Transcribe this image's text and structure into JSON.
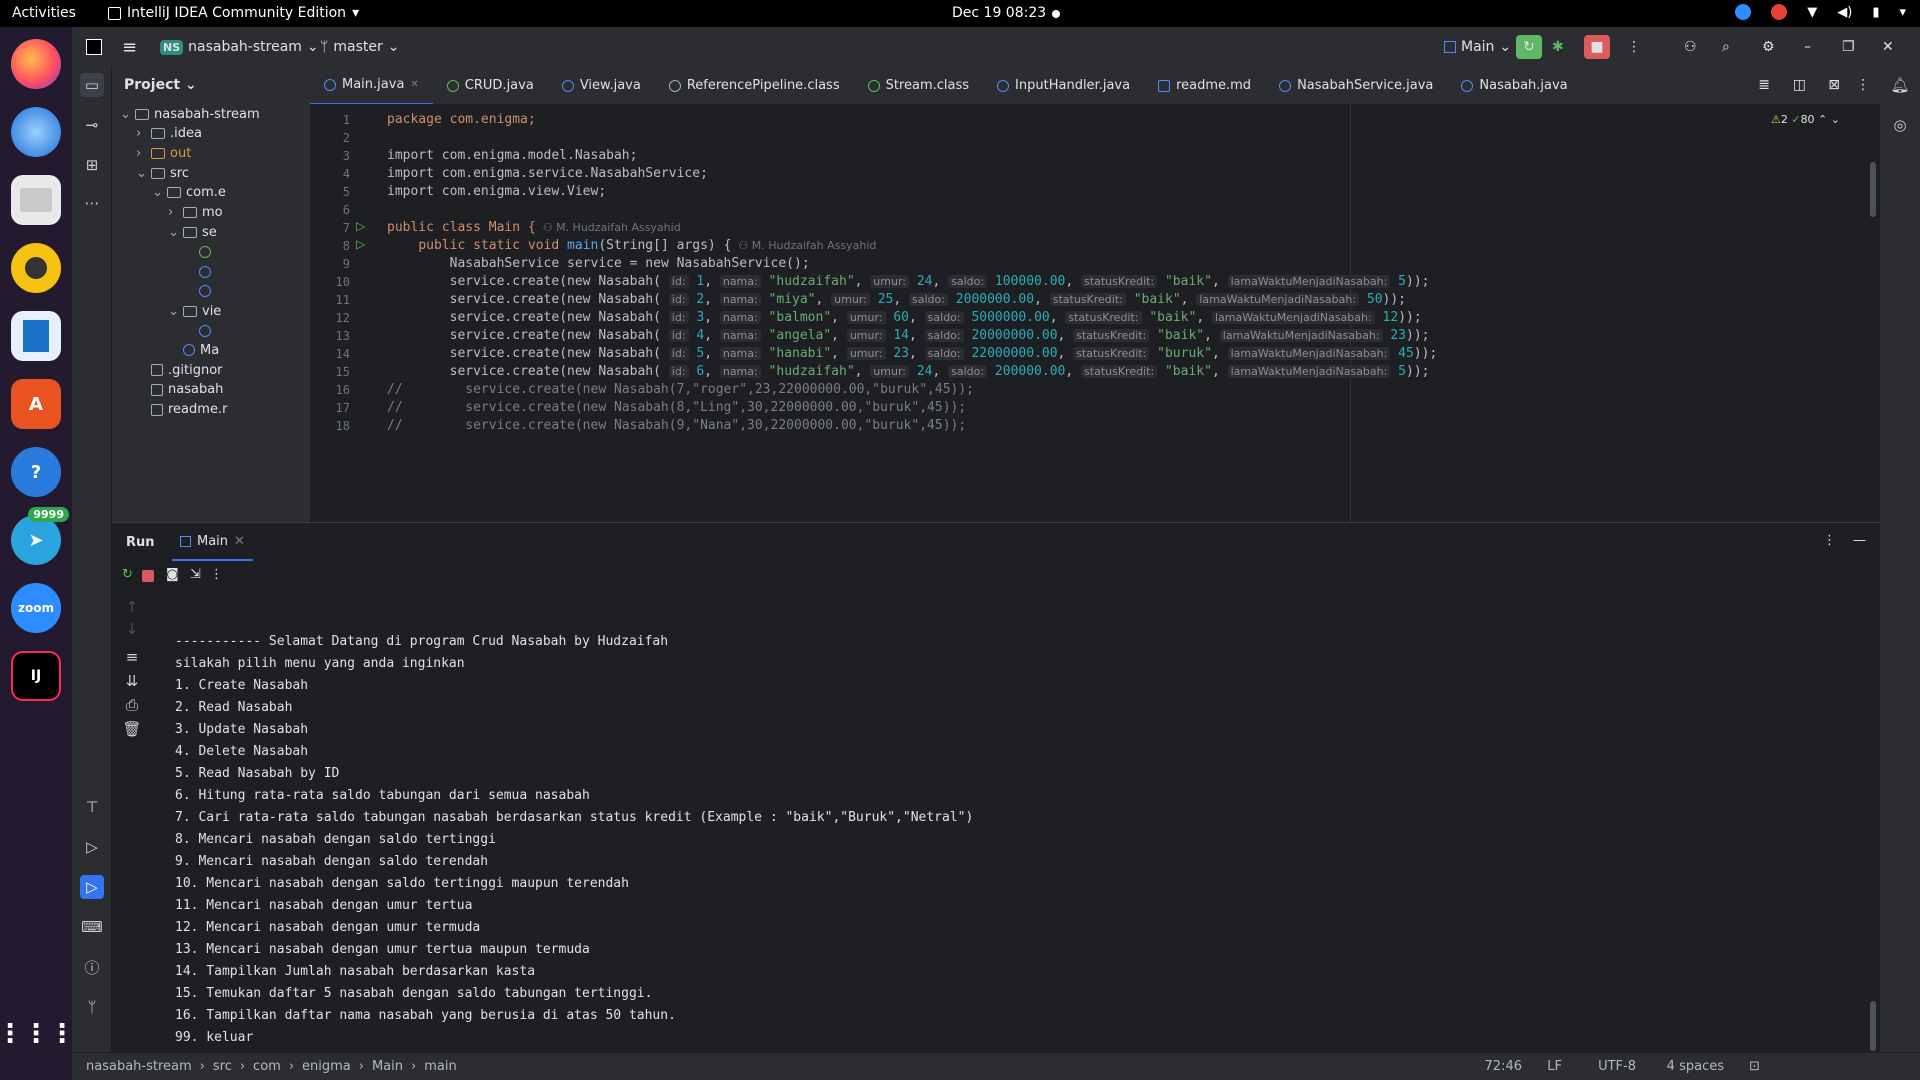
{
  "topbar": {
    "activities": "Activities",
    "app_name": "IntelliJ IDEA Community Edition",
    "datetime": "Dec 19  08:23"
  },
  "dock": {
    "telegram_badge": "9999",
    "zoom_label": "zoom",
    "intellij_label": "IJ"
  },
  "header": {
    "project_badge": "NS",
    "project_name": "nasabah-stream",
    "branch": "master",
    "run_config": "Main"
  },
  "project_panel": {
    "title": "Project",
    "items": [
      {
        "label": "nasabah-stream",
        "depth": 0,
        "kind": "folder",
        "expanded": true
      },
      {
        "label": ".idea",
        "depth": 1,
        "kind": "folder",
        "expanded": false
      },
      {
        "label": "out",
        "depth": 1,
        "kind": "folder-orange",
        "expanded": false
      },
      {
        "label": "src",
        "depth": 1,
        "kind": "folder",
        "expanded": true
      },
      {
        "label": "com.e",
        "depth": 2,
        "kind": "package",
        "expanded": true
      },
      {
        "label": "mo",
        "depth": 3,
        "kind": "package",
        "expanded": false
      },
      {
        "label": "se",
        "depth": 3,
        "kind": "package",
        "expanded": true
      },
      {
        "label": "",
        "depth": 4,
        "kind": "iface"
      },
      {
        "label": "",
        "depth": 4,
        "kind": "class"
      },
      {
        "label": "",
        "depth": 4,
        "kind": "class"
      },
      {
        "label": "vie",
        "depth": 3,
        "kind": "package",
        "expanded": true
      },
      {
        "label": "",
        "depth": 4,
        "kind": "class"
      },
      {
        "label": "Ma",
        "depth": 3,
        "kind": "class"
      },
      {
        "label": ".gitignor",
        "depth": 1,
        "kind": "file"
      },
      {
        "label": "nasabah",
        "depth": 1,
        "kind": "file"
      },
      {
        "label": "readme.r",
        "depth": 1,
        "kind": "md"
      }
    ]
  },
  "tabs": [
    {
      "label": "Main.java",
      "active": true
    },
    {
      "label": "CRUD.java"
    },
    {
      "label": "View.java"
    },
    {
      "label": "ReferencePipeline.class"
    },
    {
      "label": "Stream.class"
    },
    {
      "label": "InputHandler.java"
    },
    {
      "label": "readme.md"
    },
    {
      "label": "NasabahService.java"
    },
    {
      "label": "Nasabah.java"
    }
  ],
  "inspections": {
    "warnings": "2",
    "ok": "80"
  },
  "code": {
    "l1": "package com.enigma;",
    "l3": "import com.enigma.model.Nasabah;",
    "l4": "import com.enigma.service.NasabahService;",
    "l5": "import com.enigma.view.View;",
    "l7a": "public class Main {",
    "author": "M. Hudzaifah Assyahid",
    "l8a": "public static void ",
    "l8b": "main",
    "l8c": "(String[] args) {",
    "l9": "NasabahService service = new NasabahService();",
    "rows": [
      {
        "id": "1",
        "nama": "\"hudzaifah\"",
        "umur": "24",
        "saldo": "100000.00",
        "status": "\"baik\"",
        "lama": "5"
      },
      {
        "id": "2",
        "nama": "\"miya\"",
        "umur": "25",
        "saldo": "2000000.00",
        "status": "\"baik\"",
        "lama": "50"
      },
      {
        "id": "3",
        "nama": "\"balmon\"",
        "umur": "60",
        "saldo": "5000000.00",
        "status": "\"baik\"",
        "lama": "12"
      },
      {
        "id": "4",
        "nama": "\"angela\"",
        "umur": "14",
        "saldo": "20000000.00",
        "status": "\"baik\"",
        "lama": "23"
      },
      {
        "id": "5",
        "nama": "\"hanabi\"",
        "umur": "23",
        "saldo": "22000000.00",
        "status": "\"buruk\"",
        "lama": "45"
      },
      {
        "id": "6",
        "nama": "\"hudzaifah\"",
        "umur": "24",
        "saldo": "200000.00",
        "status": "\"baik\"",
        "lama": "5"
      }
    ],
    "hint_id": "id:",
    "hint_nama": "nama:",
    "hint_umur": "umur:",
    "hint_saldo": "saldo:",
    "hint_status": "statusKredit:",
    "hint_lama": "lamaWaktuMenjadiNasabah:",
    "c16": "//        service.create(new Nasabah(7,\"roger\",23,22000000.00,\"buruk\",45));",
    "c17": "//        service.create(new Nasabah(8,\"Ling\",30,22000000.00,\"buruk\",45));",
    "c18": "//        service.create(new Nasabah(9,\"Nana\",30,22000000.00,\"buruk\",45));"
  },
  "run": {
    "title": "Run",
    "tab": "Main"
  },
  "console": [
    "----------- Selamat Datang di program Crud Nasabah by Hudzaifah",
    "silakah pilih menu yang anda inginkan",
    "1. Create Nasabah",
    "2. Read Nasabah",
    "3. Update Nasabah",
    "4. Delete Nasabah",
    "5. Read Nasabah by ID",
    "6. Hitung rata-rata saldo tabungan dari semua nasabah",
    "7. Cari rata-rata saldo tabungan nasabah berdasarkan status kredit (Example : \"baik\",\"Buruk\",\"Netral\")",
    "8. Mencari nasabah dengan saldo tertinggi",
    "9. Mencari nasabah dengan saldo terendah",
    "10. Mencari nasabah dengan saldo tertinggi maupun terendah",
    "11. Mencari nasabah dengan umur tertua",
    "12. Mencari nasabah dengan umur termuda",
    "13. Mencari nasabah dengan umur tertua maupun termuda",
    "14. Tampilkan Jumlah nasabah berdasarkan kasta",
    "15. Temukan daftar 5 nasabah dengan saldo tabungan tertinggi.",
    "16. Tampilkan daftar nama nasabah yang berusia di atas 50 tahun.",
    "99. keluar",
    "--------------------------------------"
  ],
  "status": {
    "crumbs": [
      "nasabah-stream",
      "src",
      "com",
      "enigma",
      "Main",
      "main"
    ],
    "position": "72:46",
    "eol": "LF",
    "encoding": "UTF-8",
    "indent": "4 spaces"
  },
  "colors": {
    "accent": "#3574f0",
    "keyword": "#cf8e6d",
    "string": "#6aab73",
    "number": "#2aacb8"
  }
}
